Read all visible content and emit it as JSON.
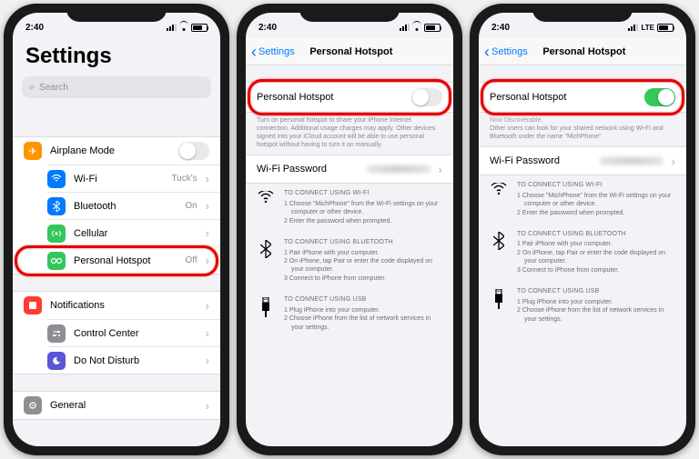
{
  "status": {
    "time": "2:40",
    "carrier_type_p1": "wifi",
    "carrier_type_p23": "LTE"
  },
  "phone1": {
    "title": "Settings",
    "search_placeholder": "Search",
    "group1": [
      {
        "icon": "airplane",
        "label": "Airplane Mode",
        "accessory": "toggle-off"
      },
      {
        "icon": "wifi",
        "label": "Wi-Fi",
        "value": "Tuck's"
      },
      {
        "icon": "bluetooth",
        "label": "Bluetooth",
        "value": "On"
      },
      {
        "icon": "cellular",
        "label": "Cellular",
        "value": ""
      },
      {
        "icon": "hotspot",
        "label": "Personal Hotspot",
        "value": "Off"
      }
    ],
    "group2": [
      {
        "icon": "notifications",
        "label": "Notifications"
      },
      {
        "icon": "controlcenter",
        "label": "Control Center"
      },
      {
        "icon": "dnd",
        "label": "Do Not Disturb"
      }
    ],
    "group3": [
      {
        "icon": "general",
        "label": "General"
      }
    ]
  },
  "phone2": {
    "back": "Settings",
    "title": "Personal Hotspot",
    "toggle_label": "Personal Hotspot",
    "toggle_on": false,
    "help": "Turn on personal hotspot to share your iPhone Internet connection. Additional usage charges may apply. Other devices signed into your iCloud account will be able to use personal hotspot without having to turn it on manually.",
    "wifi_pw_label": "Wi-Fi Password"
  },
  "phone3": {
    "back": "Settings",
    "title": "Personal Hotspot",
    "toggle_label": "Personal Hotspot",
    "toggle_on": true,
    "discover_title": "Now Discoverable.",
    "discover_body": "Other users can look for your shared network using Wi-Fi and Bluetooth under the name \"MichPhone\".",
    "wifi_pw_label": "Wi-Fi Password"
  },
  "instructions": {
    "wifi": {
      "title": "TO CONNECT USING WI-FI",
      "steps": [
        "Choose \"MichPhone\" from the Wi-Fi settings on your computer or other device.",
        "Enter the password when prompted."
      ]
    },
    "bt": {
      "title": "TO CONNECT USING BLUETOOTH",
      "steps": [
        "Pair iPhone with your computer.",
        "On iPhone, tap Pair or enter the code displayed on your computer.",
        "Connect to iPhone from computer."
      ]
    },
    "usb": {
      "title": "TO CONNECT USING USB",
      "steps": [
        "Plug iPhone into your computer.",
        "Choose iPhone from the list of network services in your settings."
      ]
    }
  }
}
